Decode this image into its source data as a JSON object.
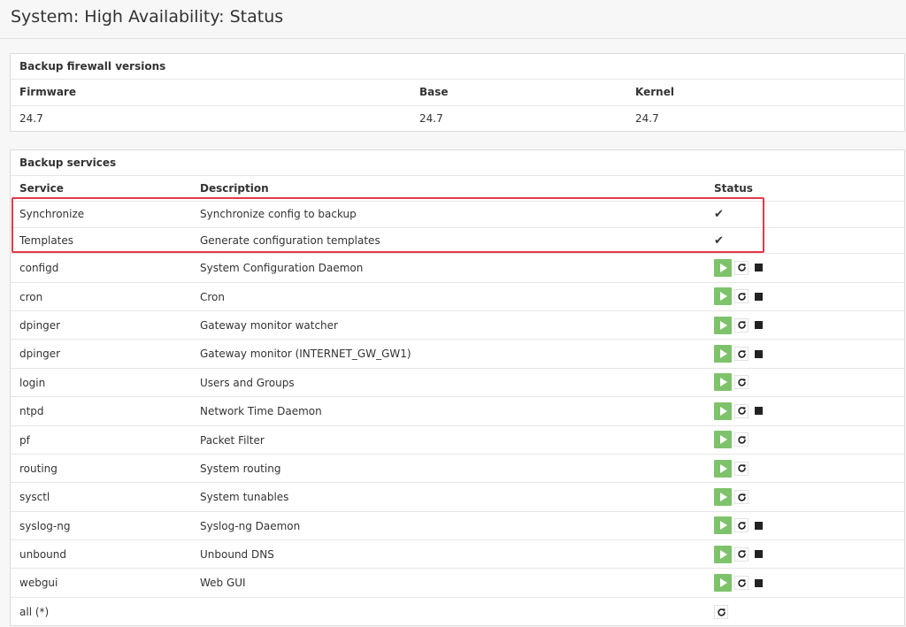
{
  "page": {
    "title": "System: High Availability: Status"
  },
  "versions": {
    "title": "Backup firewall versions",
    "headers": {
      "firmware": "Firmware",
      "base": "Base",
      "kernel": "Kernel"
    },
    "values": {
      "firmware": "24.7",
      "base": "24.7",
      "kernel": "24.7"
    }
  },
  "services": {
    "title": "Backup services",
    "headers": {
      "service": "Service",
      "description": "Description",
      "status": "Status"
    },
    "checkmark": "✔",
    "rows": [
      {
        "service": "Synchronize",
        "description": "Synchronize config to backup",
        "status": "check"
      },
      {
        "service": "Templates",
        "description": "Generate configuration templates",
        "status": "check"
      },
      {
        "service": "configd",
        "description": "System Configuration Daemon",
        "status": "start,restart,stop"
      },
      {
        "service": "cron",
        "description": "Cron",
        "status": "start,restart,stop"
      },
      {
        "service": "dpinger",
        "description": "Gateway monitor watcher",
        "status": "start,restart,stop"
      },
      {
        "service": "dpinger",
        "description": "Gateway monitor (INTERNET_GW_GW1)",
        "status": "start,restart,stop"
      },
      {
        "service": "login",
        "description": "Users and Groups",
        "status": "start,restart"
      },
      {
        "service": "ntpd",
        "description": "Network Time Daemon",
        "status": "start,restart,stop"
      },
      {
        "service": "pf",
        "description": "Packet Filter",
        "status": "start,restart"
      },
      {
        "service": "routing",
        "description": "System routing",
        "status": "start,restart"
      },
      {
        "service": "sysctl",
        "description": "System tunables",
        "status": "start,restart"
      },
      {
        "service": "syslog-ng",
        "description": "Syslog-ng Daemon",
        "status": "start,restart,stop"
      },
      {
        "service": "unbound",
        "description": "Unbound DNS",
        "status": "start,restart,stop"
      },
      {
        "service": "webgui",
        "description": "Web GUI",
        "status": "start,restart,stop"
      },
      {
        "service": "all (*)",
        "description": "",
        "status": "restart"
      }
    ]
  },
  "icons": {
    "start": "play-icon",
    "restart": "refresh-icon",
    "stop": "stop-icon",
    "check": "check-icon"
  },
  "colors": {
    "start_button": "#7ec36b",
    "highlight": "#e33a4a"
  }
}
